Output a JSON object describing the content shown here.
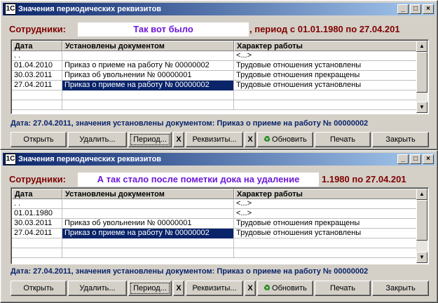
{
  "windows": [
    {
      "title": "Значения периодических реквизитов",
      "employees_label": "Сотрудники:",
      "employee_value": "Так вот было",
      "period_text": ", период с 01.01.1980 по 27.04.201",
      "columns": [
        "Дата",
        "Установлены документом",
        "Характер работы"
      ],
      "rows": [
        {
          "date": ". .",
          "doc": "",
          "kind": "<...>"
        },
        {
          "date": "01.04.2010",
          "doc": "Приказ о приеме на работу № 00000002",
          "kind": "Трудовые отношения установлены"
        },
        {
          "date": "30.03.2011",
          "doc": "Приказ об увольнении № 00000001",
          "kind": "Трудовые отношения прекращены"
        },
        {
          "date": "27.04.2011",
          "doc": "Приказ о приеме на работу № 00000002",
          "kind": "Трудовые отношения установлены",
          "selected": true
        },
        {
          "date": "",
          "doc": "",
          "kind": ""
        },
        {
          "date": "",
          "doc": "",
          "kind": ""
        }
      ],
      "status": "Дата: 27.04.2011, значения установлены документом: Приказ о приеме на работу № 00000002",
      "buttons": {
        "open": "Открыть",
        "delete": "Удалить...",
        "period": "Период...",
        "x1": "X",
        "props": "Реквизиты...",
        "x2": "X",
        "refresh": "Обновить",
        "print": "Печать",
        "close": "Закрыть"
      }
    },
    {
      "title": "Значения периодических реквизитов",
      "employees_label": "Сотрудники:",
      "employee_value": "А так стало после пометки дока на удаление",
      "period_text": "1.1980 по 27.04.201",
      "columns": [
        "Дата",
        "Установлены документом",
        "Характер работы"
      ],
      "rows": [
        {
          "date": ". .",
          "doc": "",
          "kind": "<...>"
        },
        {
          "date": "01.01.1980",
          "doc": "",
          "kind": "<...>"
        },
        {
          "date": "30.03.2011",
          "doc": "Приказ об увольнении № 00000001",
          "kind": "Трудовые отношения прекращены"
        },
        {
          "date": "27.04.2011",
          "doc": "Приказ о приеме на работу № 00000002",
          "kind": "Трудовые отношения установлены",
          "selected": true
        },
        {
          "date": "",
          "doc": "",
          "kind": ""
        },
        {
          "date": "",
          "doc": "",
          "kind": ""
        }
      ],
      "status": "Дата: 27.04.2011, значения установлены документом: Приказ о приеме на работу № 00000002",
      "buttons": {
        "open": "Открыть",
        "delete": "Удалить...",
        "period": "Период...",
        "x1": "X",
        "props": "Реквизиты...",
        "x2": "X",
        "refresh": "Обновить",
        "print": "Печать",
        "close": "Закрыть"
      }
    }
  ],
  "titlebar_buttons": {
    "minimize": "_",
    "maximize": "□",
    "close": "×"
  },
  "scroll": {
    "up": "▲",
    "down": "▼"
  },
  "icons": {
    "app": "1C",
    "refresh": "♻"
  },
  "colors": {
    "title_bar": "#0a246a",
    "employees_label": "#800000",
    "employee_value": "#6c18d8",
    "status": "#0a246a",
    "selection": "#0a246a"
  }
}
